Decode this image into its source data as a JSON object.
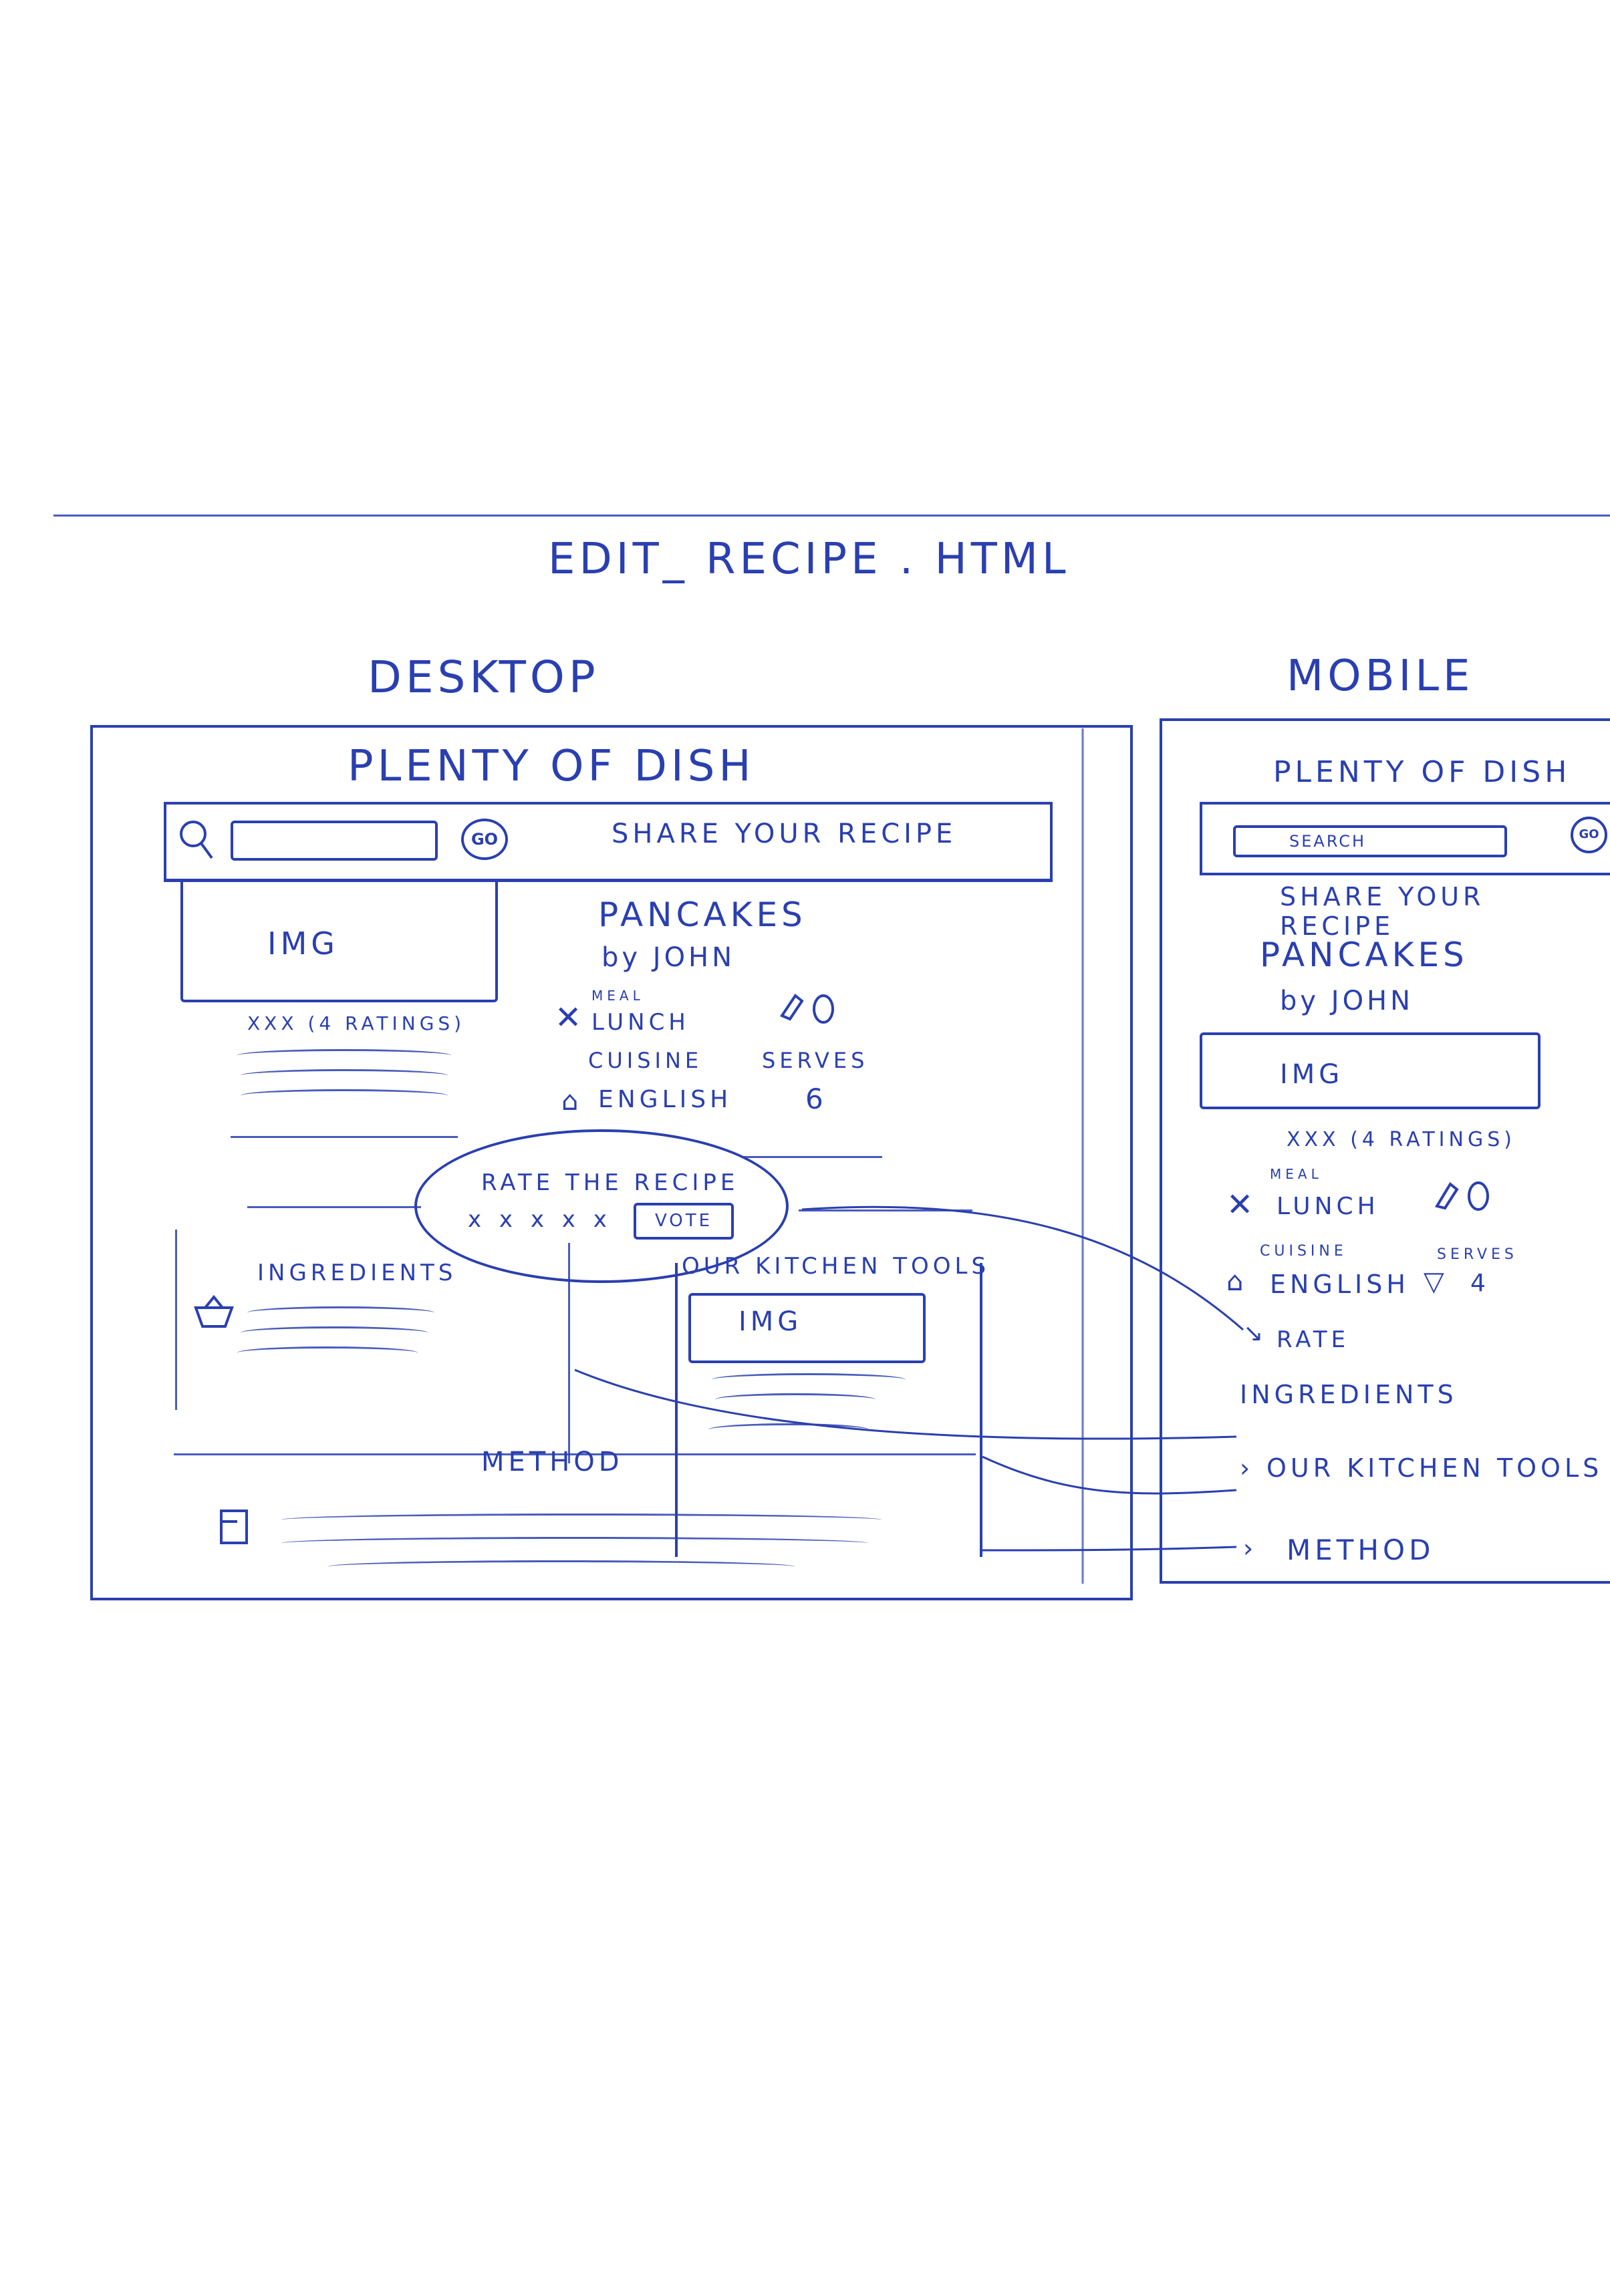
{
  "sheet": {
    "title": "EDIT_ RECIPE . HTML"
  },
  "desktop": {
    "heading": "DESKTOP",
    "brand": "PLENTY OF DISH",
    "go": "GO",
    "share": "SHARE YOUR RECIPE",
    "img": "IMG",
    "rating": "xxx (4 RATINGS)",
    "title": "PANCAKES",
    "by": "by JOHN",
    "meal_label": "MEAL",
    "meal_value": "LUNCH",
    "cuisine_label": "CUISINE",
    "cuisine_value": "ENGLISH",
    "serves_label": "SERVES",
    "serves_value": "6",
    "rate_title": "RATE THE RECIPE",
    "rate_stars": "x x x x x",
    "vote": "VOTE",
    "ingredients": "INGREDIENTS",
    "tools": "OUR KITCHEN TOOLS",
    "tools_img": "IMG",
    "method": "METHOD"
  },
  "mobile": {
    "heading": "MOBILE",
    "brand": "PLENTY OF DISH",
    "search": "SEARCH",
    "go": "GO",
    "share": "SHARE YOUR RECIPE",
    "title": "PANCAKES",
    "by": "by JOHN",
    "img": "IMG",
    "rating": "xxx (4 RATINGS)",
    "meal_label": "MEAL",
    "meal_value": "LUNCH",
    "cuisine_label": "CUISINE",
    "cuisine_value": "ENGLISH",
    "serves_label": "SERVES",
    "serves_value": "4",
    "rate": "RATE",
    "ingredients": "INGREDIENTS",
    "tools": "OUR KITCHEN TOOLS",
    "method": "METHOD"
  },
  "colors": {
    "ink": "#2a3fb0",
    "paper": "#ffffff"
  }
}
